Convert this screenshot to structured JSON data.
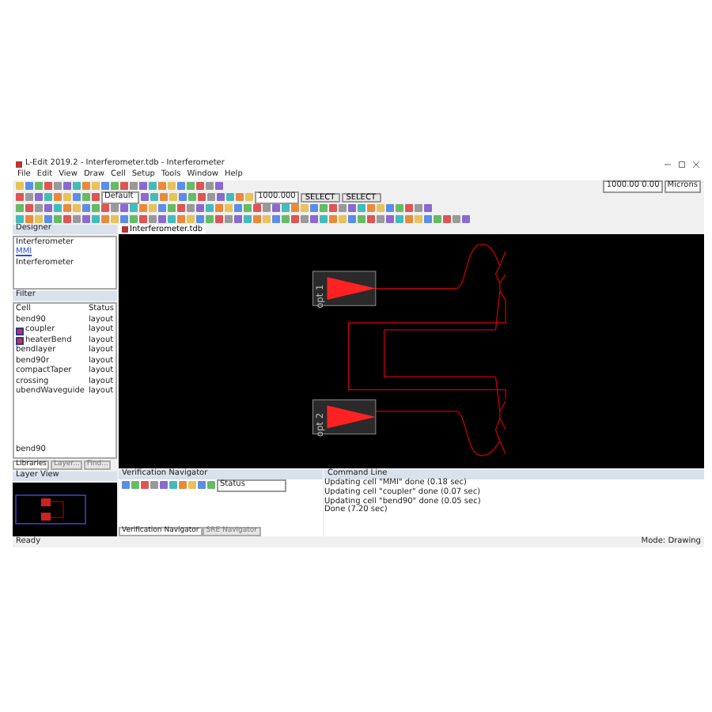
{
  "window": {
    "title": "L-Edit 2019.2 - Interferometer.tdb - Interferometer"
  },
  "menu": [
    "File",
    "Edit",
    "View",
    "Draw",
    "Cell",
    "Setup",
    "Tools",
    "Window",
    "Help"
  ],
  "toolbar": {
    "coords": "1000.00  0.00",
    "units": "Microns",
    "layer": "Default",
    "grid": "1000.000",
    "modes": [
      "SELECT",
      "SELECT"
    ]
  },
  "designer": {
    "title": "Designer",
    "header": "Interferometer",
    "items": [
      {
        "label": "MMI",
        "selected": true
      },
      {
        "label": "Interferometer",
        "selected": false
      }
    ]
  },
  "library": {
    "filter": "Filter",
    "columns": [
      "Cell",
      "Status"
    ],
    "rows": [
      {
        "cell": "bend90",
        "status": "layout",
        "icon": false
      },
      {
        "cell": "coupler",
        "status": "layout",
        "icon": true
      },
      {
        "cell": "heaterBend",
        "status": "layout",
        "icon": true
      },
      {
        "cell": "bendlayer",
        "status": "layout",
        "icon": false
      },
      {
        "cell": "bend90r",
        "status": "layout",
        "icon": false
      },
      {
        "cell": "compactTaper",
        "status": "layout",
        "icon": false
      },
      {
        "cell": "crossing",
        "status": "layout",
        "icon": false
      },
      {
        "cell": "ubendWaveguide",
        "status": "layout",
        "icon": false
      }
    ],
    "footer": "bend90",
    "tabs": [
      {
        "label": "Libraries",
        "selected": true
      },
      {
        "label": "Layer...",
        "selected": false
      },
      {
        "label": "Find...",
        "selected": false
      }
    ]
  },
  "layer_view": {
    "title": "Layer View"
  },
  "document_tab": "Interferometer.tdb",
  "canvas": {
    "ports": [
      "opt 1",
      "opt 2"
    ]
  },
  "verification": {
    "title": "Verification Navigator",
    "filter": "Status",
    "tabs": [
      {
        "label": "Verification Navigator",
        "selected": true
      },
      {
        "label": "SRE Navigator",
        "selected": false
      }
    ]
  },
  "command_line": {
    "title": "Command Line",
    "lines": [
      "Updating cell \"MMI\" done (0.18 sec)",
      "Updating cell \"coupler\" done (0.07 sec)",
      "Updating cell \"bend90\" done (0.05 sec)",
      "Done (7.20 sec)"
    ]
  },
  "status_bar": {
    "left": "Ready",
    "right": "Mode: Drawing"
  }
}
